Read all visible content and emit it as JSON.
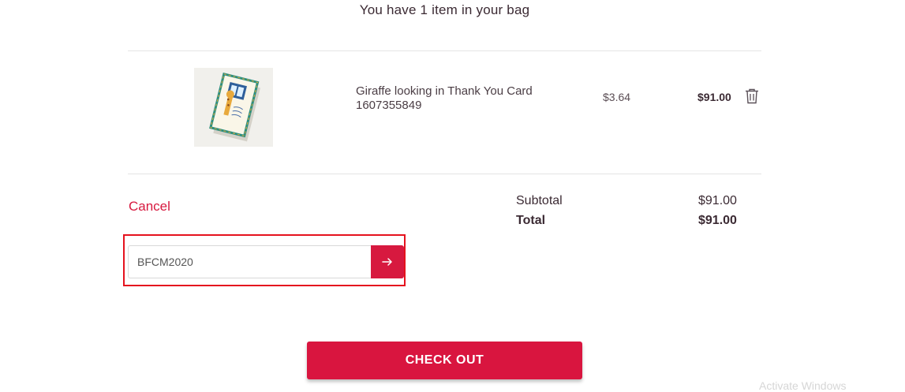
{
  "header": {
    "title": "You have 1 item in your bag"
  },
  "cart": {
    "items": [
      {
        "name": "Giraffe looking in Thank You Card",
        "sku": "1607355849",
        "unit_price": "$3.64",
        "line_total": "$91.00",
        "thumbnail_icon": "card-thumbnail-image",
        "remove_icon": "trash-icon"
      }
    ]
  },
  "promo": {
    "cancel_label": "Cancel",
    "code_value": "BFCM2020",
    "submit_icon": "arrow-right-icon"
  },
  "summary": {
    "subtotal_label": "Subtotal",
    "subtotal_value": "$91.00",
    "total_label": "Total",
    "total_value": "$91.00"
  },
  "checkout": {
    "label": "CHECK OUT"
  },
  "watermark": {
    "text": "Activate Windows"
  },
  "colors": {
    "accent": "#d7193f",
    "highlight_border": "#e5121e",
    "text_dark": "#3b2a33"
  }
}
